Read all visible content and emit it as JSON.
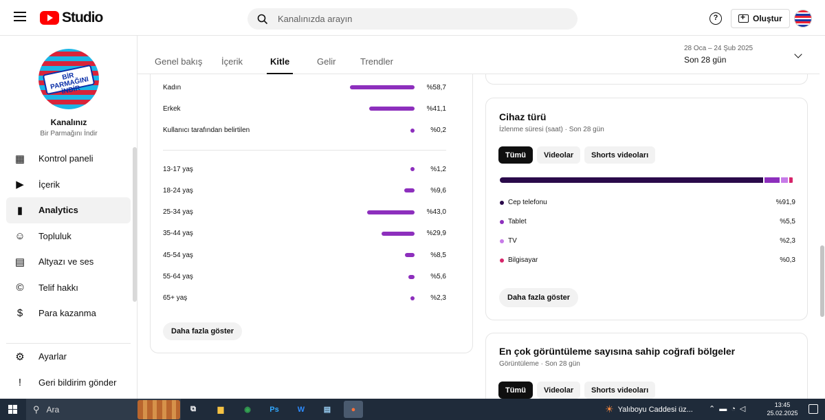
{
  "header": {
    "logo_text": "Studio",
    "search_placeholder": "Kanalınızda arayın",
    "create_label": "Oluştur"
  },
  "sidebar": {
    "channel_title": "Kanalınız",
    "channel_name": "Bir Parmağını İndir",
    "avatar_text": "BİR PARMAĞINI İNDİR",
    "items": [
      {
        "label": "Kontrol paneli",
        "icon": "dashboard-icon",
        "glyph": "▦"
      },
      {
        "label": "İçerik",
        "icon": "content-icon",
        "glyph": "▶"
      },
      {
        "label": "Analytics",
        "icon": "analytics-icon",
        "glyph": "▮",
        "active": true
      },
      {
        "label": "Topluluk",
        "icon": "community-icon",
        "glyph": "☺"
      },
      {
        "label": "Altyazı ve ses",
        "icon": "subtitles-icon",
        "glyph": "▤"
      },
      {
        "label": "Telif hakkı",
        "icon": "copyright-icon",
        "glyph": "©"
      },
      {
        "label": "Para kazanma",
        "icon": "dollar-icon",
        "glyph": "$"
      }
    ],
    "bottom_items": [
      {
        "label": "Ayarlar",
        "icon": "settings-icon",
        "glyph": "⚙"
      },
      {
        "label": "Geri bildirim gönder",
        "icon": "feedback-icon",
        "glyph": "!"
      }
    ]
  },
  "tabs": {
    "items": [
      "Genel bakış",
      "İçerik",
      "Kitle",
      "Gelir",
      "Trendler"
    ],
    "active_index": 2,
    "date_range": "28 Oca – 24 Şub 2025",
    "period_label": "Son 28 gün"
  },
  "demographics": {
    "gender": [
      {
        "label": "Kadın",
        "value": "%58,7",
        "fraction": 0.587
      },
      {
        "label": "Erkek",
        "value": "%41,1",
        "fraction": 0.411
      },
      {
        "label": "Kullanıcı tarafından belirtilen",
        "value": "%0,2",
        "fraction": 0.002
      }
    ],
    "age": [
      {
        "label": "13-17 yaş",
        "value": "%1,2",
        "fraction": 0.012
      },
      {
        "label": "18-24 yaş",
        "value": "%9,6",
        "fraction": 0.096
      },
      {
        "label": "25-34 yaş",
        "value": "%43,0",
        "fraction": 0.43
      },
      {
        "label": "35-44 yaş",
        "value": "%29,9",
        "fraction": 0.299
      },
      {
        "label": "45-54 yaş",
        "value": "%8,5",
        "fraction": 0.085
      },
      {
        "label": "55-64 yaş",
        "value": "%5,6",
        "fraction": 0.056
      },
      {
        "label": "65+ yaş",
        "value": "%2,3",
        "fraction": 0.023
      }
    ],
    "show_more": "Daha fazla göster"
  },
  "device": {
    "title": "Cihaz türü",
    "subtitle": "İzlenme süresi (saat) · Son 28 gün",
    "filters": [
      "Tümü",
      "Videolar",
      "Shorts videoları"
    ],
    "rows": [
      {
        "label": "Cep telefonu",
        "value": "%91,9",
        "fraction": 0.919,
        "color": "#2a0a4a"
      },
      {
        "label": "Tablet",
        "value": "%5,5",
        "fraction": 0.055,
        "color": "#8d2fbd"
      },
      {
        "label": "TV",
        "value": "%2,3",
        "fraction": 0.023,
        "color": "#c77be8"
      },
      {
        "label": "Bilgisayar",
        "value": "%0,3",
        "fraction": 0.003,
        "color": "#d6256a"
      }
    ],
    "show_more": "Daha fazla göster"
  },
  "geography": {
    "title": "En çok görüntüleme sayısına sahip coğrafi bölgeler",
    "subtitle": "Görüntüleme · Son 28 gün",
    "filters": [
      "Tümü",
      "Videolar",
      "Shorts videoları"
    ]
  },
  "taskbar": {
    "search_label": "Ara",
    "weather_text": "Yalıboyu Caddesi üz...",
    "time": "13:45",
    "date": "25.02.2025",
    "apps": [
      {
        "label": "",
        "icon": "task-view-icon",
        "color": "#ffffff",
        "glyph": "⧉"
      },
      {
        "label": "",
        "icon": "file-explorer-icon",
        "color": "#f6c343",
        "glyph": "▆"
      },
      {
        "label": "",
        "icon": "chrome-icon",
        "color": "#34a853",
        "glyph": "◉"
      },
      {
        "label": "Ps",
        "icon": "photoshop-icon",
        "color": "#31a8ff",
        "glyph": "Ps"
      },
      {
        "label": "",
        "icon": "app-icon",
        "color": "#2d8cff",
        "glyph": "W"
      },
      {
        "label": "",
        "icon": "notepad-icon",
        "color": "#9ad0f5",
        "glyph": "▤"
      },
      {
        "label": "",
        "icon": "firefox-icon",
        "color": "#ff7139",
        "glyph": "●"
      }
    ]
  },
  "colors": {
    "accent_bar": "#8d2fbd",
    "youtube_red": "#ff0000",
    "taskbar_bg": "#1f2b3a"
  }
}
